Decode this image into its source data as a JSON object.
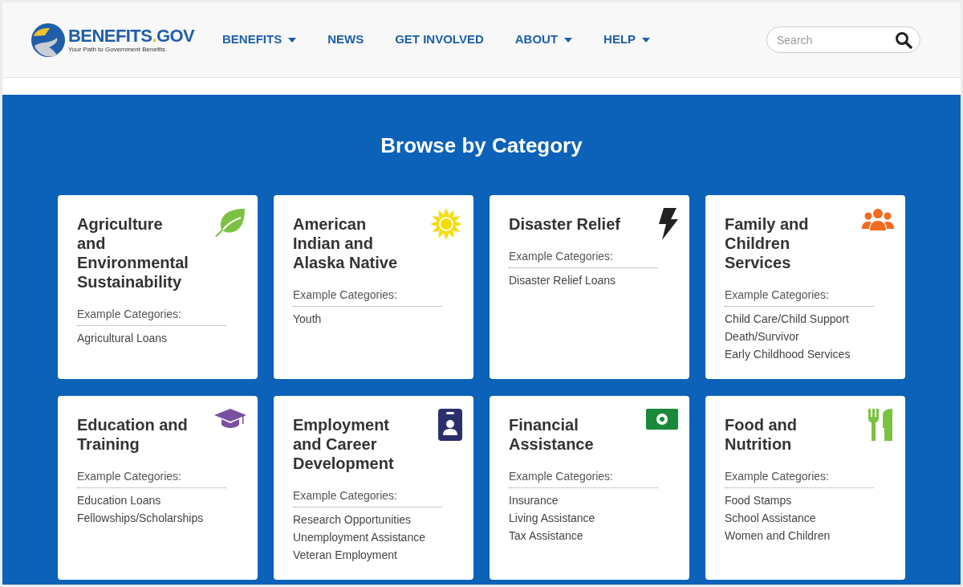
{
  "logo": {
    "name": "BENEFITS",
    "domain": ".GOV",
    "tagline": "Your Path to Government Benefits"
  },
  "nav": [
    {
      "label": "BENEFITS",
      "dropdown": true
    },
    {
      "label": "NEWS",
      "dropdown": false
    },
    {
      "label": "GET INVOLVED",
      "dropdown": false
    },
    {
      "label": "ABOUT",
      "dropdown": true
    },
    {
      "label": "HELP",
      "dropdown": true
    }
  ],
  "search": {
    "placeholder": "Search"
  },
  "heading": "Browse by Category",
  "cards": [
    {
      "title": "Agriculture and Environmental Sustainability",
      "label": "Example Categories:",
      "items": [
        "Agricultural Loans"
      ]
    },
    {
      "title": "American Indian and Alaska Native",
      "label": "Example Categories:",
      "items": [
        "Youth"
      ]
    },
    {
      "title": "Disaster Relief",
      "label": "Example Categories:",
      "items": [
        "Disaster Relief Loans"
      ]
    },
    {
      "title": "Family and Children Services",
      "label": "Example Categories:",
      "items": [
        "Child Care/Child Support",
        "Death/Survivor",
        "Early Childhood Services"
      ]
    },
    {
      "title": "Education and Training",
      "label": "Example Categories:",
      "items": [
        "Education Loans",
        "Fellowships/Scholarships"
      ]
    },
    {
      "title": "Employment and Career Development",
      "label": "Example Categories:",
      "items": [
        "Research Opportunities",
        "Unemployment Assistance",
        "Veteran Employment"
      ]
    },
    {
      "title": "Financial Assistance",
      "label": "Example Categories:",
      "items": [
        "Insurance",
        "Living Assistance",
        "Tax Assistance"
      ]
    },
    {
      "title": "Food and Nutrition",
      "label": "Example Categories:",
      "items": [
        "Food Stamps",
        "School Assistance",
        "Women and Children"
      ]
    }
  ]
}
